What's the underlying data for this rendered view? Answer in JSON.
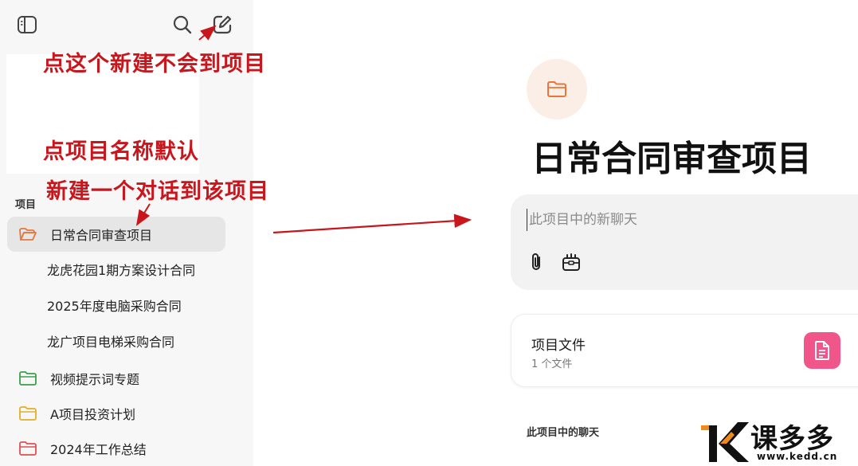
{
  "sidebar": {
    "toggle_icon": "sidebar-toggle-icon",
    "search_icon": "search-icon",
    "new_chat_icon": "new-chat-icon",
    "section_label": "项目",
    "projects": [
      {
        "label": "日常合同审查项目",
        "color": "#e8763a",
        "active": true
      },
      {
        "label": "视频提示词专题",
        "color": "#3aa04a"
      },
      {
        "label": "A项目投资计划",
        "color": "#e0b028"
      },
      {
        "label": "2024年工作总结",
        "color": "#e05050"
      }
    ],
    "conversations": [
      {
        "label": "龙虎花园1期方案设计合同"
      },
      {
        "label": "2025年度电脑采购合同"
      },
      {
        "label": "龙广项目电梯采购合同"
      }
    ]
  },
  "annotations": {
    "note1": "点这个新建不会到项目",
    "note2_line1": "点项目名称默认",
    "note2_line2": "新建一个对话到该项目"
  },
  "main": {
    "project_title": "日常合同审查项目",
    "composer_placeholder": "此项目中的新聊天",
    "files_title": "项目文件",
    "files_count": "1 个文件",
    "chats_heading": "此项目中的聊天"
  },
  "brand": {
    "name": "课多多",
    "url": "www.kedd.cn"
  },
  "colors": {
    "annotation": "#c8161d",
    "folder_accent": "#e8763a",
    "file_icon_bg": "#f0568a"
  }
}
